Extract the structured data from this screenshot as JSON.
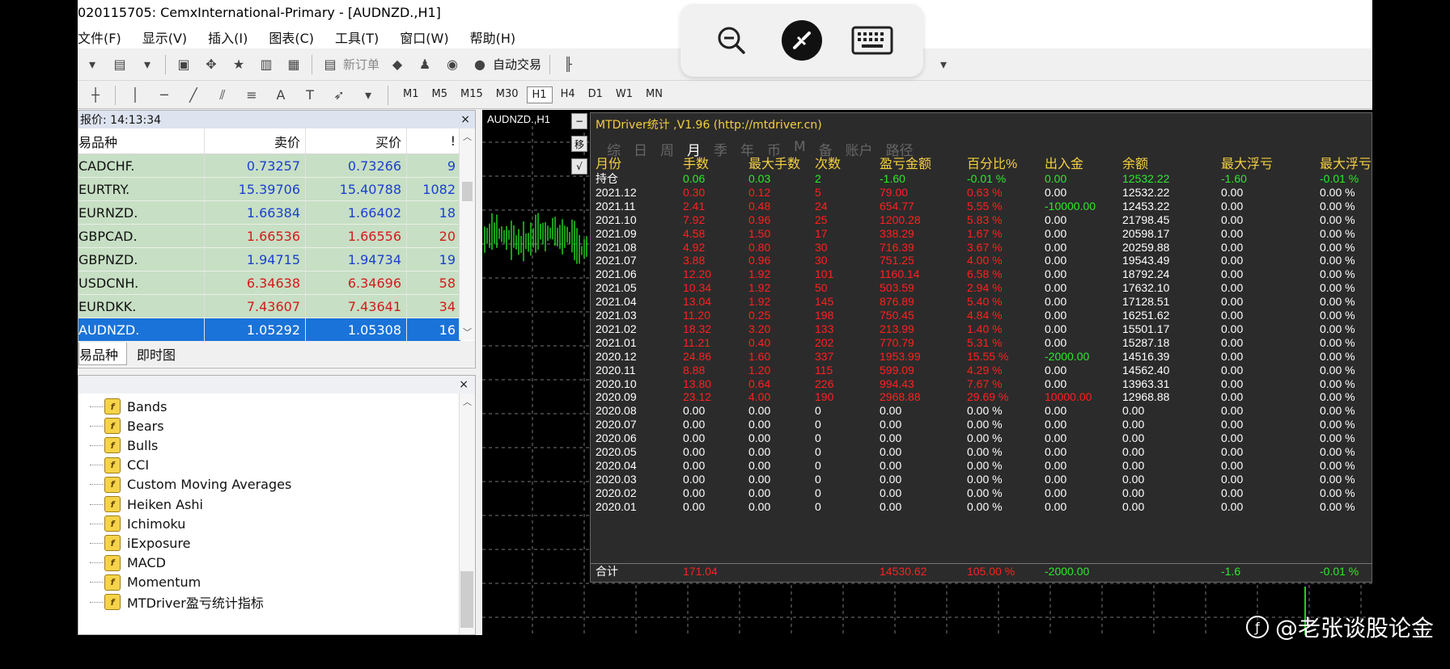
{
  "window": {
    "title": "020115705: CemxInternational-Primary - [AUDNZD.,H1]"
  },
  "menu": [
    "文件(F)",
    "显示(V)",
    "插入(I)",
    "图表(C)",
    "工具(T)",
    "窗口(W)",
    "帮助(H)"
  ],
  "toolbar": {
    "new_order": "新订单",
    "auto_trade": "自动交易"
  },
  "timeframes": [
    "M1",
    "M5",
    "M15",
    "M30",
    "H1",
    "H4",
    "D1",
    "W1",
    "MN"
  ],
  "active_timeframe": "H1",
  "drawing_tools": {
    "text_tool": "A",
    "label_tool": "T"
  },
  "market_watch": {
    "title": "报价: 14:13:34",
    "close": "×",
    "columns": {
      "symbol": "易品种",
      "bid": "卖价",
      "ask": "买价",
      "spread": "!"
    },
    "rows": [
      {
        "symbol": "CADCHF.",
        "bid": "0.73257",
        "ask": "0.73266",
        "spread": "9",
        "color": "blue"
      },
      {
        "symbol": "EURTRY.",
        "bid": "15.39706",
        "ask": "15.40788",
        "spread": "1082",
        "color": "blue"
      },
      {
        "symbol": "EURNZD.",
        "bid": "1.66384",
        "ask": "1.66402",
        "spread": "18",
        "color": "blue"
      },
      {
        "symbol": "GBPCAD.",
        "bid": "1.66536",
        "ask": "1.66556",
        "spread": "20",
        "color": "red"
      },
      {
        "symbol": "GBPNZD.",
        "bid": "1.94715",
        "ask": "1.94734",
        "spread": "19",
        "color": "blue"
      },
      {
        "symbol": "USDCNH.",
        "bid": "6.34638",
        "ask": "6.34696",
        "spread": "58",
        "color": "red"
      },
      {
        "symbol": "EURDKK.",
        "bid": "7.43607",
        "ask": "7.43641",
        "spread": "34",
        "color": "red"
      },
      {
        "symbol": "AUDNZD.",
        "bid": "1.05292",
        "ask": "1.05308",
        "spread": "16",
        "color": "blue",
        "selected": true
      }
    ],
    "tabs": [
      "易品种",
      "即时图"
    ]
  },
  "navigator": {
    "close": "×",
    "items": [
      "Bands",
      "Bears",
      "Bulls",
      "CCI",
      "Custom Moving Averages",
      "Heiken Ashi",
      "Ichimoku",
      "iExposure",
      "MACD",
      "Momentum",
      "MTDriver盈亏统计指标"
    ]
  },
  "chart": {
    "label": "AUDNZD.,H1",
    "stats": {
      "title": "MTDriver统计 ,V1.96 (http://mtdriver.cn)",
      "tabs": [
        "综",
        "日",
        "周",
        "月",
        "季",
        "年",
        "币",
        "M",
        "备",
        "账户",
        "路径"
      ],
      "active_tab": "月",
      "side_buttons": [
        "−",
        "移",
        "√"
      ],
      "headers": [
        "月份",
        "手数",
        "最大手数",
        "次数",
        "盈亏金额",
        "百分比%",
        "出入金",
        "余额",
        "最大浮亏",
        "最大浮亏"
      ],
      "rows": [
        {
          "cells": [
            "持仓",
            "0.06",
            "0.03",
            "2",
            "-1.60",
            "-0.01 %",
            "0.00",
            "12532.22",
            "-1.60",
            "-0.01 %"
          ],
          "tone": "open"
        },
        {
          "cells": [
            "2021.12",
            "0.30",
            "0.12",
            "5",
            "79.00",
            "0.63 %",
            "0.00",
            "12532.22",
            "0.00",
            "0.00 %"
          ],
          "tone": "red"
        },
        {
          "cells": [
            "2021.11",
            "2.41",
            "0.48",
            "24",
            "654.77",
            "5.55 %",
            "-10000.00",
            "12453.22",
            "0.00",
            "0.00 %"
          ],
          "tone": "red",
          "flow": "green"
        },
        {
          "cells": [
            "2021.10",
            "7.92",
            "0.96",
            "25",
            "1200.28",
            "5.83 %",
            "0.00",
            "21798.45",
            "0.00",
            "0.00 %"
          ],
          "tone": "red"
        },
        {
          "cells": [
            "2021.09",
            "4.58",
            "1.50",
            "17",
            "338.29",
            "1.67 %",
            "0.00",
            "20598.17",
            "0.00",
            "0.00 %"
          ],
          "tone": "red"
        },
        {
          "cells": [
            "2021.08",
            "4.92",
            "0.80",
            "30",
            "716.39",
            "3.67 %",
            "0.00",
            "20259.88",
            "0.00",
            "0.00 %"
          ],
          "tone": "red"
        },
        {
          "cells": [
            "2021.07",
            "3.88",
            "0.96",
            "30",
            "751.25",
            "4.00 %",
            "0.00",
            "19543.49",
            "0.00",
            "0.00 %"
          ],
          "tone": "red"
        },
        {
          "cells": [
            "2021.06",
            "12.20",
            "1.92",
            "101",
            "1160.14",
            "6.58 %",
            "0.00",
            "18792.24",
            "0.00",
            "0.00 %"
          ],
          "tone": "red"
        },
        {
          "cells": [
            "2021.05",
            "10.34",
            "1.92",
            "50",
            "503.59",
            "2.94 %",
            "0.00",
            "17632.10",
            "0.00",
            "0.00 %"
          ],
          "tone": "red"
        },
        {
          "cells": [
            "2021.04",
            "13.04",
            "1.92",
            "145",
            "876.89",
            "5.40 %",
            "0.00",
            "17128.51",
            "0.00",
            "0.00 %"
          ],
          "tone": "red"
        },
        {
          "cells": [
            "2021.03",
            "11.20",
            "0.25",
            "198",
            "750.45",
            "4.84 %",
            "0.00",
            "16251.62",
            "0.00",
            "0.00 %"
          ],
          "tone": "red"
        },
        {
          "cells": [
            "2021.02",
            "18.32",
            "3.20",
            "133",
            "213.99",
            "1.40 %",
            "0.00",
            "15501.17",
            "0.00",
            "0.00 %"
          ],
          "tone": "red"
        },
        {
          "cells": [
            "2021.01",
            "11.21",
            "0.40",
            "202",
            "770.79",
            "5.31 %",
            "0.00",
            "15287.18",
            "0.00",
            "0.00 %"
          ],
          "tone": "red"
        },
        {
          "cells": [
            "2020.12",
            "24.86",
            "1.60",
            "337",
            "1953.99",
            "15.55 %",
            "-2000.00",
            "14516.39",
            "0.00",
            "0.00 %"
          ],
          "tone": "red",
          "flow": "green"
        },
        {
          "cells": [
            "2020.11",
            "8.88",
            "1.20",
            "115",
            "599.09",
            "4.29 %",
            "0.00",
            "14562.40",
            "0.00",
            "0.00 %"
          ],
          "tone": "red"
        },
        {
          "cells": [
            "2020.10",
            "13.80",
            "0.64",
            "226",
            "994.43",
            "7.67 %",
            "0.00",
            "13963.31",
            "0.00",
            "0.00 %"
          ],
          "tone": "red"
        },
        {
          "cells": [
            "2020.09",
            "23.12",
            "4.00",
            "190",
            "2968.88",
            "29.69 %",
            "10000.00",
            "12968.88",
            "0.00",
            "0.00 %"
          ],
          "tone": "red",
          "flow": "red"
        },
        {
          "cells": [
            "2020.08",
            "0.00",
            "0.00",
            "0",
            "0.00",
            "0.00 %",
            "0.00",
            "0.00",
            "0.00",
            "0.00 %"
          ],
          "tone": "zero"
        },
        {
          "cells": [
            "2020.07",
            "0.00",
            "0.00",
            "0",
            "0.00",
            "0.00 %",
            "0.00",
            "0.00",
            "0.00",
            "0.00 %"
          ],
          "tone": "zero"
        },
        {
          "cells": [
            "2020.06",
            "0.00",
            "0.00",
            "0",
            "0.00",
            "0.00 %",
            "0.00",
            "0.00",
            "0.00",
            "0.00 %"
          ],
          "tone": "zero"
        },
        {
          "cells": [
            "2020.05",
            "0.00",
            "0.00",
            "0",
            "0.00",
            "0.00 %",
            "0.00",
            "0.00",
            "0.00",
            "0.00 %"
          ],
          "tone": "zero"
        },
        {
          "cells": [
            "2020.04",
            "0.00",
            "0.00",
            "0",
            "0.00",
            "0.00 %",
            "0.00",
            "0.00",
            "0.00",
            "0.00 %"
          ],
          "tone": "zero"
        },
        {
          "cells": [
            "2020.03",
            "0.00",
            "0.00",
            "0",
            "0.00",
            "0.00 %",
            "0.00",
            "0.00",
            "0.00",
            "0.00 %"
          ],
          "tone": "zero"
        },
        {
          "cells": [
            "2020.02",
            "0.00",
            "0.00",
            "0",
            "0.00",
            "0.00 %",
            "0.00",
            "0.00",
            "0.00",
            "0.00 %"
          ],
          "tone": "zero"
        },
        {
          "cells": [
            "2020.01",
            "0.00",
            "0.00",
            "0",
            "0.00",
            "0.00 %",
            "0.00",
            "0.00",
            "0.00",
            "0.00 %"
          ],
          "tone": "zero"
        }
      ],
      "total": {
        "cells": [
          "合计",
          "171.04",
          "",
          "",
          "14530.62",
          "105.00 %",
          "-2000.00",
          "",
          "-1.6",
          "-0.01 %"
        ]
      }
    }
  },
  "overlay": {
    "buttons": [
      "zoom-out",
      "disconnect",
      "keyboard"
    ]
  },
  "watermark": {
    "text": "@老张谈股论金"
  }
}
